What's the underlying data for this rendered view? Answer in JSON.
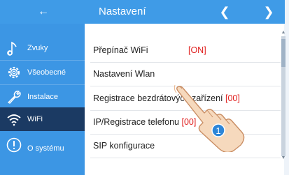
{
  "header": {
    "title": "Nastavení",
    "back_icon": "back-arrow-icon",
    "prev_icon": "chevron-left-icon",
    "next_icon": "chevron-right-icon"
  },
  "sidebar": {
    "items": [
      {
        "label": "Zvuky",
        "icon": "music-note-icon"
      },
      {
        "label": "Všeobecné",
        "icon": "gear-icon"
      },
      {
        "label": "Instalace",
        "icon": "wrench-icon"
      },
      {
        "label": "WiFi",
        "icon": "wifi-icon",
        "active": true
      },
      {
        "label": "O systému",
        "icon": "info-icon"
      }
    ]
  },
  "main": {
    "rows": [
      {
        "label": "Přepínač WiFi",
        "value": "[ON]"
      },
      {
        "label": "Nastavení Wlan",
        "value": ""
      },
      {
        "label": "Registrace bezdrátových zařízení",
        "value": "[00]"
      },
      {
        "label": "IP/Registrace telefonu",
        "value": "[00]"
      },
      {
        "label": "SIP konfigurace",
        "value": ""
      }
    ]
  },
  "overlay": {
    "step_badge": "1",
    "pointer_icon": "hand-pointer-icon"
  },
  "colors": {
    "header": "#3f9be7",
    "sidebar": "#3c96e4",
    "active_item": "#1b3a63",
    "value_red": "#e0201f"
  }
}
